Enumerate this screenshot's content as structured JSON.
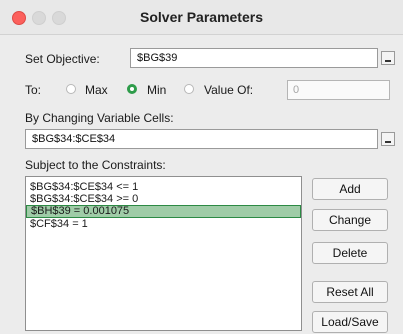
{
  "window": {
    "title": "Solver Parameters"
  },
  "objective": {
    "label": "Set Objective:",
    "value": "$BG$39"
  },
  "to": {
    "label": "To:",
    "options": [
      {
        "label": "Max",
        "selected": false
      },
      {
        "label": "Min",
        "selected": true
      },
      {
        "label": "Value Of:",
        "selected": false
      }
    ],
    "value_of": "0"
  },
  "changing": {
    "label": "By Changing Variable Cells:",
    "value": "$BG$34:$CE$34"
  },
  "constraints": {
    "label": "Subject to the Constraints:",
    "items": [
      {
        "text": "$BG$34:$CE$34 <= 1",
        "selected": false
      },
      {
        "text": "$BG$34:$CE$34 >= 0",
        "selected": false
      },
      {
        "text": "$BH$39 = 0.001075",
        "selected": true
      },
      {
        "text": "$CF$34 = 1",
        "selected": false
      }
    ]
  },
  "buttons": {
    "add": "Add",
    "change": "Change",
    "delete": "Delete",
    "reset_all": "Reset All",
    "load_save": "Load/Save"
  },
  "colors": {
    "selected_radio": "#2e9c4a",
    "selected_row": "#9fcca7",
    "close_button": "#fc605c"
  }
}
